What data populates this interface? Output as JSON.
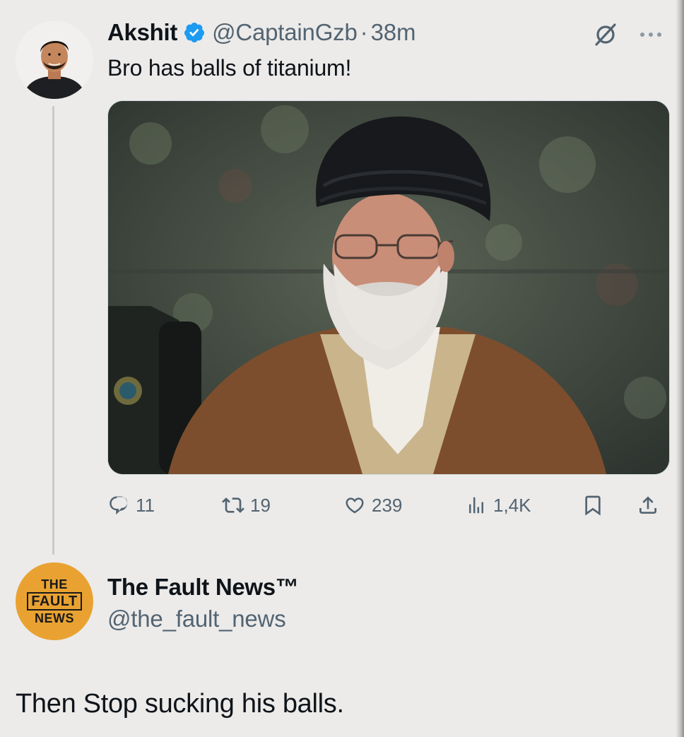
{
  "tweet": {
    "author_name": "Akshit",
    "handle": "@CaptainGzb",
    "separator": "·",
    "time": "38m",
    "text": "Bro has balls of titanium!",
    "media": "photo",
    "actions": {
      "reply_count": "11",
      "retweet_count": "19",
      "like_count": "239",
      "view_count": "1,4K"
    },
    "icons": {
      "verified": "verified-badge-icon",
      "grok": "grok-icon",
      "more": "more-icon",
      "reply": "reply-icon",
      "retweet": "retweet-icon",
      "like": "heart-icon",
      "views": "views-icon",
      "bookmark": "bookmark-icon",
      "share": "share-icon"
    }
  },
  "reply": {
    "author_name": "The Fault News™",
    "handle": "@the_fault_news",
    "avatar_logo": {
      "line1": "THE",
      "line2": "FAULT",
      "line3": "NEWS"
    },
    "text": "Then Stop sucking his balls."
  },
  "colors": {
    "background": "#ecebea",
    "text_primary": "#0f1419",
    "text_secondary": "#536471",
    "verified_blue": "#1d9bf0",
    "logo_orange": "#e9a232"
  }
}
